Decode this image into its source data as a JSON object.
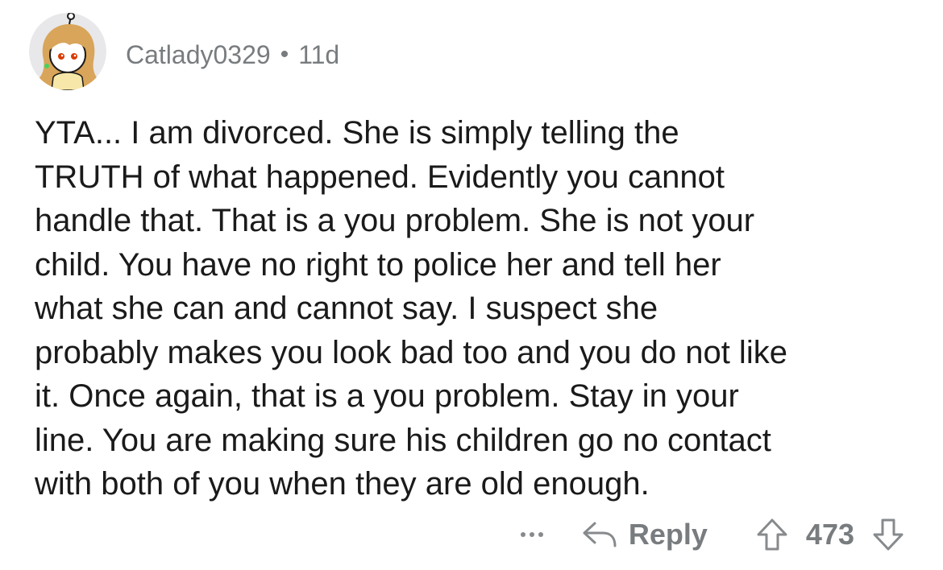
{
  "comment": {
    "author": "Catlady0329",
    "separator": "•",
    "age": "11d",
    "lines": [
      "YTA... I am divorced.  She is simply telling the",
      "TRUTH of what happened.  Evidently you cannot",
      "handle that.  That is a you problem.   She is not your",
      "child.  You have no right to police her and tell her",
      "what she can and cannot say.   I suspect she",
      "probably makes you look bad too and you do not like",
      "it.  Once again, that is a you problem.   Stay in your",
      "line.   You are making sure his children go no contact",
      "with both of you when they are old enough."
    ]
  },
  "actions": {
    "more_icon": "ellipsis-icon",
    "reply_icon": "reply-arrow-icon",
    "reply_label": "Reply",
    "upvote_icon": "upvote-arrow-icon",
    "score": "473",
    "downvote_icon": "downvote-arrow-icon"
  },
  "colors": {
    "meta_gray": "#787c7e",
    "text": "#1a1a1b",
    "avatar_bg": "#e8e8ea",
    "hair": "#d9a55a"
  }
}
